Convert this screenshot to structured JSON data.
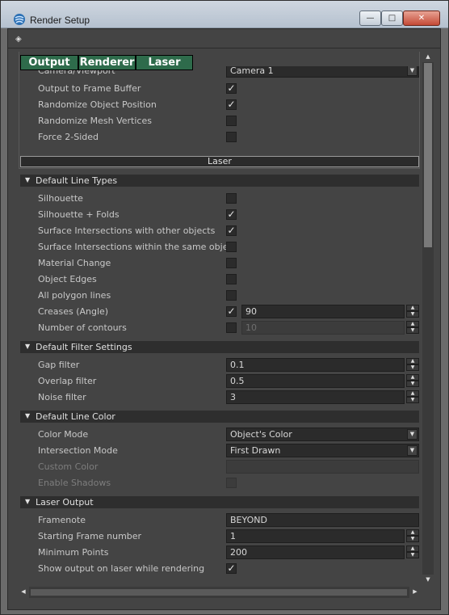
{
  "window": {
    "title": "Render Setup",
    "buttons": {
      "minimize": "—",
      "maximize": "□",
      "close": "✕"
    }
  },
  "toolbar": {
    "icon": "◈"
  },
  "tabs": [
    {
      "label": "Output"
    },
    {
      "label": "Renderer"
    },
    {
      "label": "Laser"
    }
  ],
  "output_section": {
    "rows": [
      {
        "label": "Camera/Viewport",
        "type": "dropdown",
        "value": "Camera 1"
      },
      {
        "label": "Output to Frame Buffer",
        "type": "checkbox",
        "checked": true
      },
      {
        "label": "Randomize Object Position",
        "type": "checkbox",
        "checked": true
      },
      {
        "label": "Randomize Mesh Vertices",
        "type": "checkbox",
        "checked": false
      },
      {
        "label": "Force 2-Sided",
        "type": "checkbox",
        "checked": false
      }
    ]
  },
  "laser_header": "Laser",
  "sections": {
    "line_types": {
      "title": "Default Line Types",
      "rows": [
        {
          "label": "Silhouette",
          "checked": false
        },
        {
          "label": "Silhouette + Folds",
          "checked": true
        },
        {
          "label": "Surface Intersections with other objects",
          "checked": true
        },
        {
          "label": "Surface Intersections within the same object",
          "checked": false
        },
        {
          "label": "Material Change",
          "checked": false
        },
        {
          "label": "Object Edges",
          "checked": false
        },
        {
          "label": "All polygon lines",
          "checked": false
        },
        {
          "label": "Creases (Angle)",
          "checked": true,
          "value": "90"
        },
        {
          "label": "Number of contours",
          "checked": false,
          "value": "10"
        }
      ]
    },
    "filter": {
      "title": "Default Filter Settings",
      "rows": [
        {
          "label": "Gap filter",
          "value": "0.1"
        },
        {
          "label": "Overlap filter",
          "value": "0.5"
        },
        {
          "label": "Noise filter",
          "value": "3"
        }
      ]
    },
    "line_color": {
      "title": "Default Line Color",
      "rows": [
        {
          "label": "Color Mode",
          "value": "Object's Color"
        },
        {
          "label": "Intersection Mode",
          "value": "First Drawn"
        },
        {
          "label": "Custom Color",
          "value": ""
        },
        {
          "label": "Enable Shadows",
          "checked": false
        }
      ]
    },
    "laser_output": {
      "title": "Laser Output",
      "rows": [
        {
          "label": "Framenote",
          "value": "BEYOND"
        },
        {
          "label": "Starting Frame number",
          "value": "1"
        },
        {
          "label": "Minimum Points",
          "value": "200"
        },
        {
          "label": "Show output on laser while rendering",
          "checked": true
        }
      ]
    }
  },
  "icons": {
    "app": "app-3d-icon",
    "checkmark": "✓",
    "spin_up": "▲",
    "spin_down": "▼",
    "collapse": "▼",
    "scroll_up": "▲",
    "scroll_down": "▼",
    "scroll_left": "◀",
    "scroll_right": "▶"
  },
  "colors": {
    "tab_bg": "#2e6b4b",
    "panel_bg": "#444444",
    "section_bg": "#2e2e2e",
    "field_bg": "#2b2b2b"
  }
}
